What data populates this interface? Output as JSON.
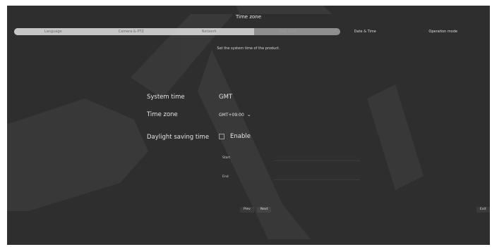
{
  "window": {
    "title": "Time zone"
  },
  "steps": [
    {
      "label": "Language",
      "state": "done"
    },
    {
      "label": "Camera & PTZ",
      "state": "done"
    },
    {
      "label": "Network",
      "state": "done"
    },
    {
      "label": "Time zone",
      "state": "current"
    },
    {
      "label": "Date & Time",
      "state": "future"
    },
    {
      "label": "Operation mode",
      "state": "future"
    }
  ],
  "description": "Set the system time of the product.",
  "form": {
    "system_time": {
      "label": "System time",
      "value": "GMT"
    },
    "time_zone": {
      "label": "Time zone",
      "value": "GMT+09:00"
    },
    "dst": {
      "label": "Daylight saving time",
      "checkbox_label": "Enable",
      "checked": false
    },
    "start_label": "Start",
    "end_label": "End"
  },
  "buttons": {
    "prev": "Prev",
    "next": "Next",
    "exit": "Exit"
  },
  "colors": {
    "background": "#2e2e2e",
    "progress_done": "#c6c6c6",
    "progress_track": "#8f8f8f"
  },
  "icons": {
    "dropdown": "chevron-down-icon",
    "checkbox": "checkbox-icon"
  }
}
